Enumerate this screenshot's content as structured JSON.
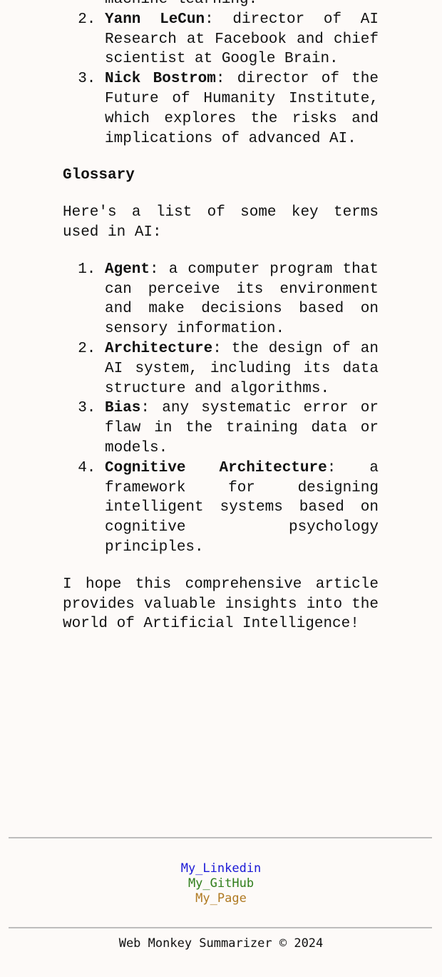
{
  "people_list_cut": {
    "item1_tail": "machine learning.",
    "items": [
      {
        "number": 2,
        "term": "Yann LeCun",
        "text": "director of AI Research at Facebook and chief scientist at Google Brain."
      },
      {
        "number": 3,
        "term": "Nick Bostrom",
        "text": "director of the Future of Humanity Institute, which explores the risks and implications of advanced AI."
      }
    ]
  },
  "glossary": {
    "heading": "Glossary",
    "intro": "Here's a list of some key terms used in AI:",
    "items": [
      {
        "term": "Agent",
        "text": "a computer program that can perceive its environment and make decisions based on sensory information."
      },
      {
        "term": "Architecture",
        "text": "the design of an AI system, including its data structure and algorithms."
      },
      {
        "term": "Bias",
        "text": "any systematic error or flaw in the training data or models."
      },
      {
        "term": "Cognitive Architecture",
        "text": "a framework for designing intelligent systems based on cognitive psychology principles."
      }
    ]
  },
  "closing": "I hope this comprehensive article provides valuable insights into the world of Artificial Intelligence!",
  "footer": {
    "links": [
      {
        "label": "My_Linkedin",
        "color": "#1a18d6"
      },
      {
        "label": "My_GitHub",
        "color": "#2f7d1a"
      },
      {
        "label": "My_Page",
        "color": "#b07a22"
      }
    ],
    "copyright": "Web Monkey Summarizer © 2024"
  }
}
